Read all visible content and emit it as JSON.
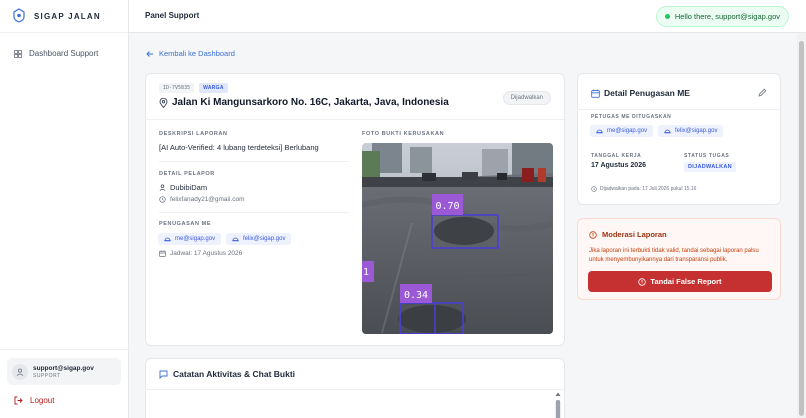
{
  "sidebar": {
    "brand": "SIGAP JALAN",
    "logo_caption": "SIGAP",
    "nav": [
      {
        "label": "Dashboard Support",
        "icon": "grid-icon"
      }
    ],
    "user": {
      "email": "support@sigap.gov",
      "role": "SUPPORT"
    },
    "logout_label": "Logout"
  },
  "header": {
    "title": "Panel Support",
    "greeting": "Hello there, support@sigap.gov"
  },
  "back_label": "Kembali ke Dashboard",
  "report": {
    "id": "ID-7V5835",
    "badge": "WARGA",
    "address": "Jalan Ki Mangunsarkoro No. 16C, Jakarta, Java, Indonesia",
    "status": "Dijadwalkan",
    "description_label": "DESKRIPSI LAPORAN",
    "description": "[AI Auto-Verified: 4 lubang terdeteksi] Berlubang",
    "reporter_label": "DETAIL PELAPOR",
    "reporter_name": "DubibiDam",
    "reporter_email": "felixfanady21@gmail.com",
    "assigned_label": "PENUGASAN ME",
    "assigned": [
      "me@sigap.gov",
      "felix@sigap.gov"
    ],
    "schedule": "Jadwal: 17 Agustus 2026",
    "photo_label": "FOTO BUKTI KERUSAKAN",
    "detections": [
      "0.70",
      "0.34",
      "1"
    ]
  },
  "chat": {
    "title": "Catatan Aktivitas & Chat Bukti"
  },
  "assignment": {
    "title": "Detail Penugasan ME",
    "officers_label": "PETUGAS ME DITUGASKAN",
    "officers": [
      "me@sigap.gov",
      "felix@sigap.gov"
    ],
    "date_label": "TANGGAL KERJA",
    "date": "17 Agustus 2026",
    "status_label": "STATUS TUGAS",
    "status": "DIJADWALKAN",
    "scheduled_at": "Dijadwalkan pada: 17 Juli 2026 pukul 15.16"
  },
  "moderation": {
    "title": "Moderasi Laporan",
    "description": "Jika laporan ini terbukti tidak valid, tandai sebagai laporan palsu untuk menyembunyikannya dari transparansi publik.",
    "button": "Tandai False Report"
  },
  "colors": {
    "accent": "#3b6fd6",
    "danger": "#c53030",
    "success": "#22c55e",
    "detection": "#9b59d6"
  }
}
